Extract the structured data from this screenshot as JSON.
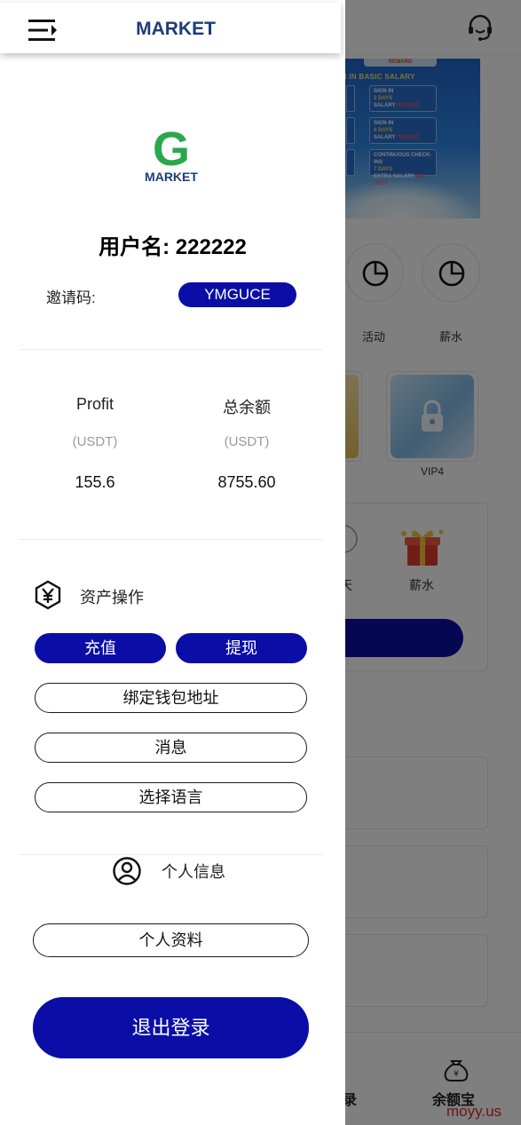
{
  "header": {
    "logo_text": "MARKET"
  },
  "background": {
    "banner": {
      "top_label": "REWARD",
      "title": "SIGN IN BASIC SALARY",
      "cards": [
        {
          "line1": "SIGN IN",
          "line2": "2 DAYS",
          "line3": "SALARY",
          "amount": "30 USDT"
        },
        {
          "line1": "SIGN IN",
          "line2": "4 DAYS",
          "line3": "SALARY",
          "amount": "70 USDT"
        },
        {
          "line1": "CONTINUOUS CHECK-INS",
          "line2": "7 DAYS",
          "line3": "EXTRA SALARY",
          "amount": "200 USDT"
        }
      ]
    },
    "quick_actions": [
      {
        "label": "活动",
        "icon": "pie-chart-icon"
      },
      {
        "label": "薪水",
        "icon": "pie-chart-icon"
      }
    ],
    "vip_label": "VIP4",
    "panel_items": [
      {
        "label": "天"
      },
      {
        "label": "薪水",
        "icon": "gift-icon"
      }
    ],
    "tabs": [
      {
        "label": "录"
      },
      {
        "label": "余额宝",
        "icon": "money-bag-icon"
      }
    ],
    "watermark": "moyy.us"
  },
  "drawer": {
    "brand": {
      "letter": "G",
      "sub_text": "MARKET"
    },
    "username_label": "用户名: 222222",
    "invite": {
      "label": "邀请码:",
      "code": "YMGUCE"
    },
    "stats": [
      {
        "title": "Profit",
        "unit": "(USDT)",
        "value": "155.6"
      },
      {
        "title": "总余额",
        "unit": "(USDT)",
        "value": "8755.60"
      }
    ],
    "assets_section": {
      "title": "资产操作",
      "icon": "yen-hexagon-icon",
      "deposit_label": "充值",
      "withdraw_label": "提现",
      "bind_wallet_label": "绑定钱包地址",
      "messages_label": "消息",
      "language_label": "选择语言"
    },
    "personal_section": {
      "title": "个人信息",
      "icon": "user-circle-icon",
      "profile_label": "个人资料"
    },
    "logout_label": "退出登录"
  },
  "colors": {
    "primary": "#0b0ea6",
    "brand_green": "#2aa84a",
    "brand_navy": "#1d3c78",
    "overlay": "rgba(0,0,0,0.5)"
  }
}
